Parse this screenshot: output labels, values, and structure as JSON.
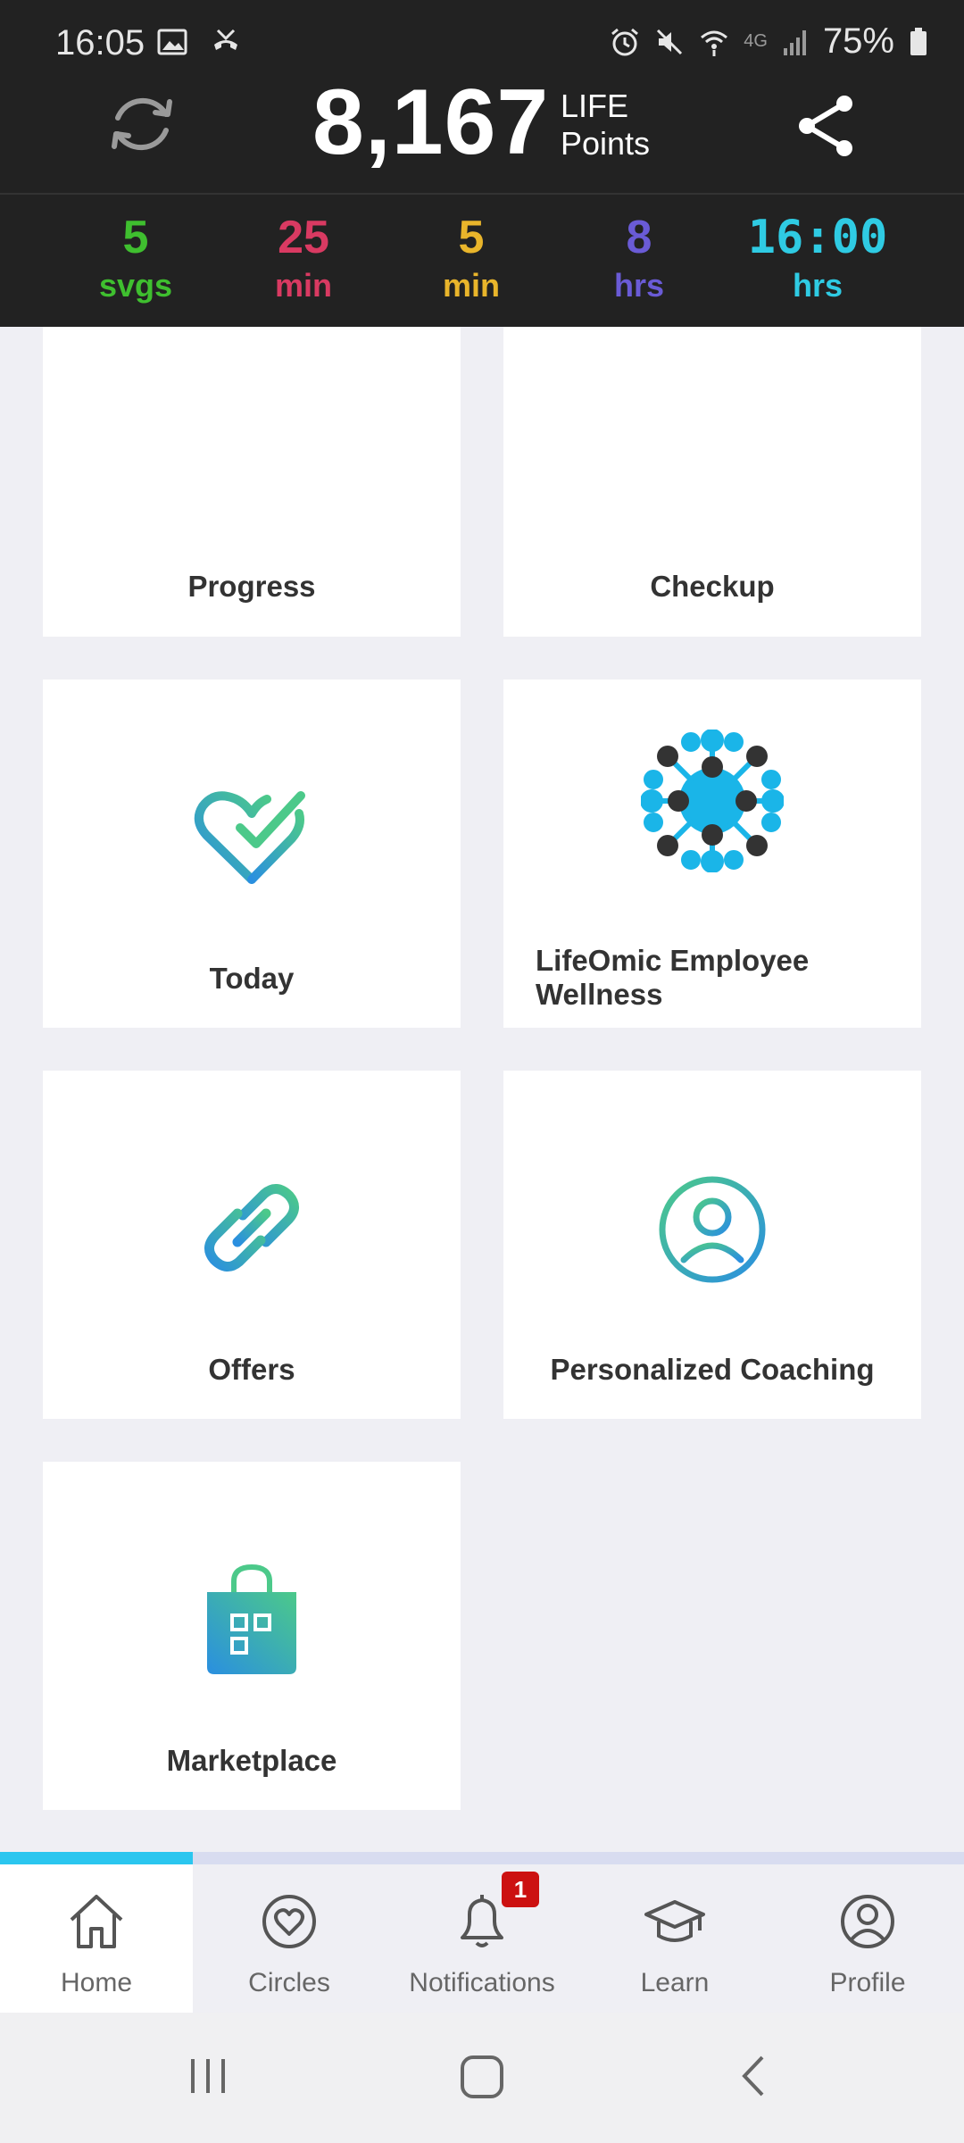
{
  "status_bar": {
    "time": "16:05",
    "network": "4G",
    "battery": "75%",
    "left_icons": [
      "image-icon",
      "missed-call-icon"
    ],
    "right_icons": [
      "alarm-icon",
      "mute-icon",
      "wifi-icon",
      "signal-icon",
      "battery-icon"
    ]
  },
  "header": {
    "points_value": "8,167",
    "points_unit_line1": "LIFE",
    "points_unit_line2": "Points"
  },
  "stats": [
    {
      "value": "5",
      "unit": "svgs",
      "color": "#3fbf2f"
    },
    {
      "value": "25",
      "unit": "min",
      "color": "#d93a62"
    },
    {
      "value": "5",
      "unit": "min",
      "color": "#e9b52b"
    },
    {
      "value": "8",
      "unit": "hrs",
      "color": "#6a5bd6"
    },
    {
      "value": "16:00",
      "unit": "hrs",
      "color": "#2fcbe3"
    }
  ],
  "tiles": [
    {
      "label": "Progress",
      "icon": "bar-chart-icon"
    },
    {
      "label": "Checkup",
      "icon": "sliders-icon"
    },
    {
      "label": "Today",
      "icon": "heart-check-icon"
    },
    {
      "label": "LifeOmic Employee Wellness",
      "icon": "molecule-logo-icon"
    },
    {
      "label": "Offers",
      "icon": "link-icon"
    },
    {
      "label": "Personalized Coaching",
      "icon": "person-circle-icon"
    },
    {
      "label": "Marketplace",
      "icon": "shopping-bag-icon"
    }
  ],
  "nav": {
    "items": [
      {
        "label": "Home",
        "icon": "home-icon"
      },
      {
        "label": "Circles",
        "icon": "heart-circle-icon"
      },
      {
        "label": "Notifications",
        "icon": "bell-icon"
      },
      {
        "label": "Learn",
        "icon": "graduation-cap-icon"
      },
      {
        "label": "Profile",
        "icon": "user-circle-icon"
      }
    ],
    "active": "Home",
    "notification_badge": "1"
  },
  "colors": {
    "header_bg": "#222222",
    "page_bg": "#efeff4",
    "accent": "#2bc6ef",
    "badge": "#cc1111",
    "gradient_blue": "#2a8fe0",
    "gradient_green": "#4cc98a"
  }
}
